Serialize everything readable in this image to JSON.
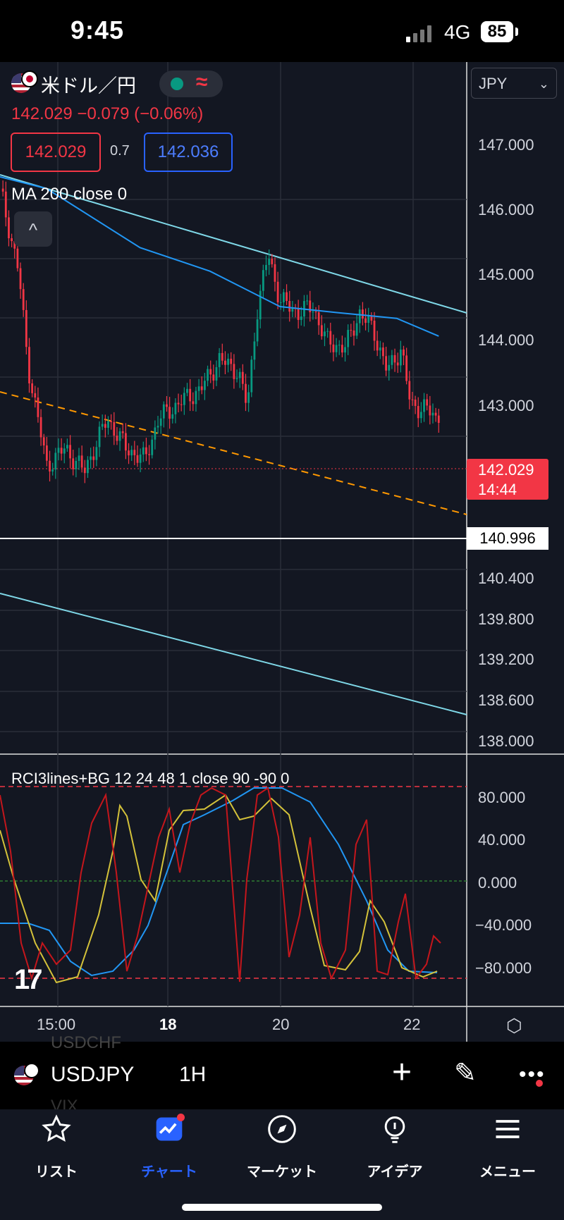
{
  "status_bar": {
    "time": "9:45",
    "network": "4G",
    "battery": "85"
  },
  "chart_header": {
    "title": "米ドル／円",
    "status_glyph": "≈",
    "quote_line": "142.029  −0.079 (−0.06%)",
    "bid": "142.029",
    "spread": "0.7",
    "ask": "142.036",
    "indicator_label": "MA 200 close 0",
    "collapse_glyph": "^"
  },
  "currency_select": {
    "value": "JPY"
  },
  "price_axis": {
    "ticks": [
      "147.000",
      "146.000",
      "145.000",
      "144.000",
      "143.000",
      "140.400",
      "139.800",
      "139.200",
      "138.600",
      "138.000"
    ],
    "last_price": "142.029",
    "countdown": "14:44",
    "hline_price": "140.996"
  },
  "rci_panel": {
    "label": "RCI3lines+BG 12 24 48 1 close 90 -90 0",
    "ticks": [
      "80.000",
      "40.000",
      "0.000",
      "−40.000",
      "−80.000"
    ]
  },
  "time_axis": {
    "ticks": [
      "15:00",
      "18",
      "20",
      "22"
    ]
  },
  "logo_text": "17",
  "symbol_bar": {
    "symbol": "USDJPY",
    "interval": "1H",
    "ghost_above": "USDCHF",
    "ghost_below": "VIX"
  },
  "tabs": [
    {
      "label": "リスト",
      "icon": "star-icon"
    },
    {
      "label": "チャート",
      "icon": "chart-icon",
      "active": true
    },
    {
      "label": "マーケット",
      "icon": "compass-icon"
    },
    {
      "label": "アイデア",
      "icon": "lightbulb-icon"
    },
    {
      "label": "メニュー",
      "icon": "menu-icon"
    }
  ],
  "colors": {
    "background": "#131722",
    "up": "#089981",
    "down": "#f23645",
    "ma": "#2196f3",
    "channel": "#7fd8e8",
    "trend": "#ff9800",
    "accent": "#2962ff",
    "rci_short": "#c4161c",
    "rci_mid": "#d4c23a",
    "rci_long": "#2196f3"
  },
  "chart_data": {
    "type": "candlestick",
    "symbol": "USDJPY",
    "interval": "1H",
    "currency": "JPY",
    "price_axis_ticks": [
      147.0,
      146.0,
      145.0,
      144.0,
      143.0,
      140.4,
      139.8,
      139.2,
      138.6,
      138.0
    ],
    "last_price": 142.029,
    "horizontal_line": 140.996,
    "time_ticks": [
      "15:00",
      "18",
      "20",
      "22"
    ],
    "close_path": [
      {
        "t": 0,
        "p": 146.0
      },
      {
        "t": 0.04,
        "p": 144.6
      },
      {
        "t": 0.06,
        "p": 143.0
      },
      {
        "t": 0.1,
        "p": 141.3
      },
      {
        "t": 0.14,
        "p": 141.6
      },
      {
        "t": 0.18,
        "p": 141.2
      },
      {
        "t": 0.23,
        "p": 142.1
      },
      {
        "t": 0.27,
        "p": 141.6
      },
      {
        "t": 0.31,
        "p": 141.4
      },
      {
        "t": 0.34,
        "p": 142.1
      },
      {
        "t": 0.39,
        "p": 142.4
      },
      {
        "t": 0.43,
        "p": 142.6
      },
      {
        "t": 0.47,
        "p": 143.1
      },
      {
        "t": 0.51,
        "p": 142.9
      },
      {
        "t": 0.53,
        "p": 142.3
      },
      {
        "t": 0.55,
        "p": 143.9
      },
      {
        "t": 0.575,
        "p": 144.9
      },
      {
        "t": 0.6,
        "p": 144.1
      },
      {
        "t": 0.64,
        "p": 143.9
      },
      {
        "t": 0.67,
        "p": 144.0
      },
      {
        "t": 0.7,
        "p": 143.4
      },
      {
        "t": 0.74,
        "p": 143.3
      },
      {
        "t": 0.77,
        "p": 143.9
      },
      {
        "t": 0.8,
        "p": 143.6
      },
      {
        "t": 0.83,
        "p": 142.9
      },
      {
        "t": 0.86,
        "p": 143.3
      },
      {
        "t": 0.88,
        "p": 142.3
      },
      {
        "t": 0.91,
        "p": 142.3
      },
      {
        "t": 0.94,
        "p": 142.03
      }
    ],
    "ma200_path": [
      {
        "t": 0,
        "p": 146.2
      },
      {
        "t": 0.1,
        "p": 146.0
      },
      {
        "t": 0.3,
        "p": 145.0
      },
      {
        "t": 0.45,
        "p": 144.6
      },
      {
        "t": 0.6,
        "p": 144.0
      },
      {
        "t": 0.72,
        "p": 143.9
      },
      {
        "t": 0.85,
        "p": 143.8
      },
      {
        "t": 0.94,
        "p": 143.5
      }
    ],
    "rci_range": [
      -100,
      100
    ],
    "rci_levels": [
      90,
      -90,
      0
    ]
  }
}
